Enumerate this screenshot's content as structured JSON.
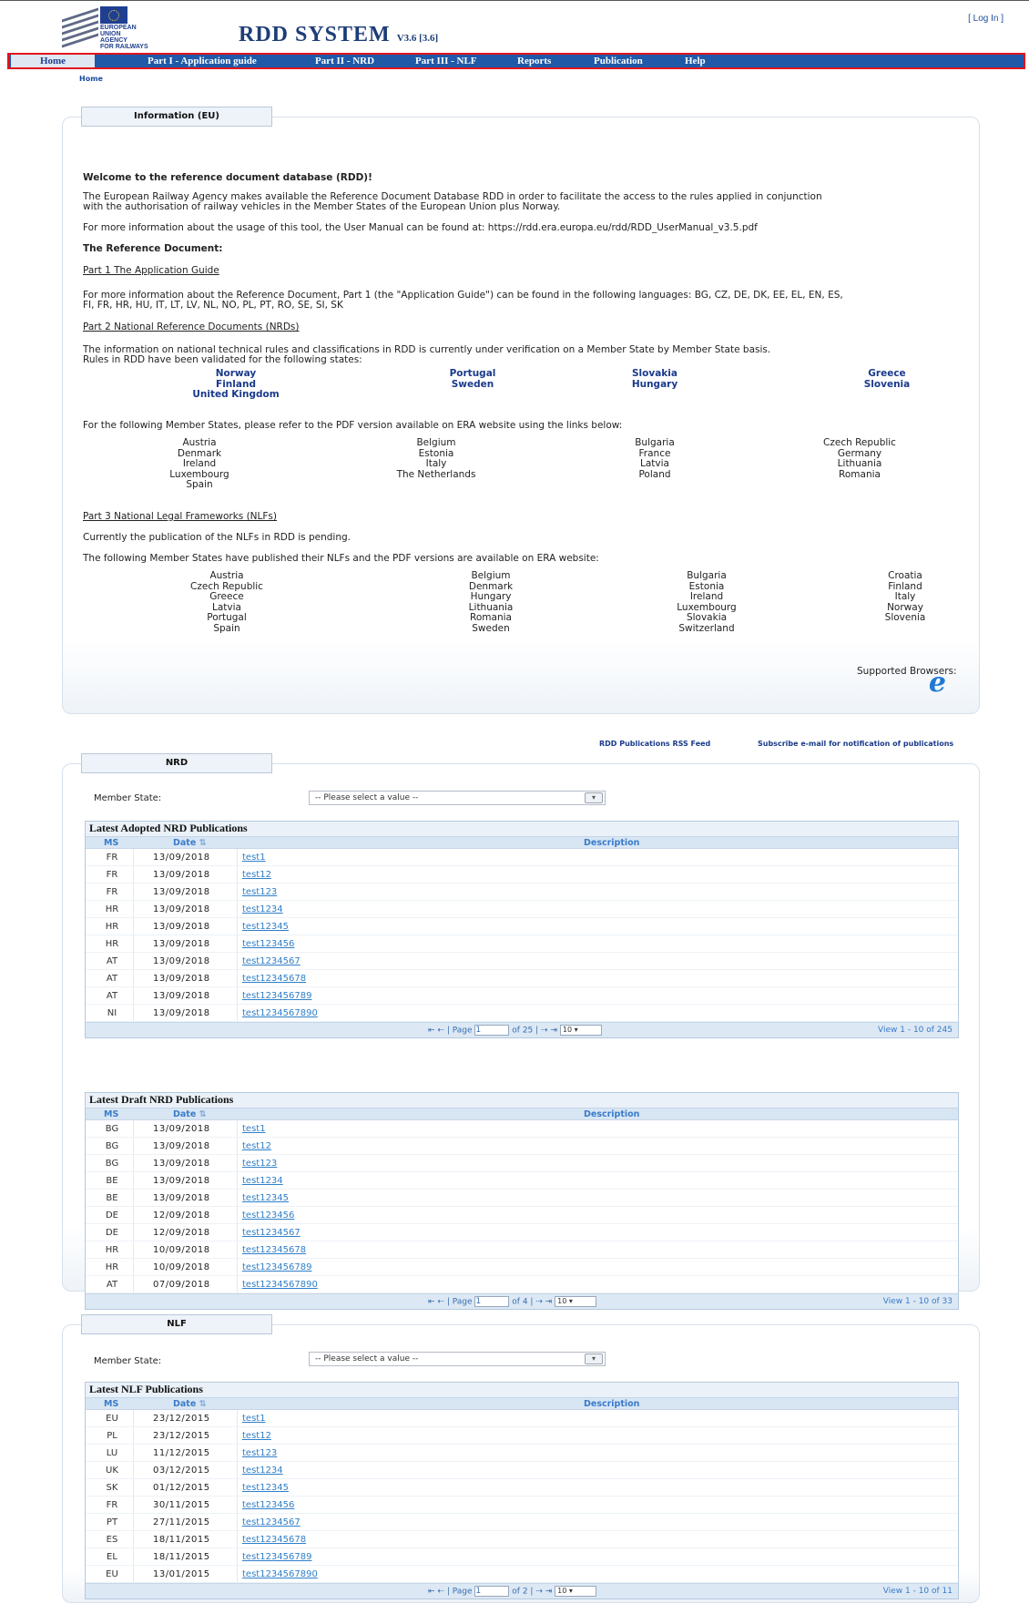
{
  "header": {
    "logo_lines": [
      "EUROPEAN",
      "UNION",
      "AGENCY",
      "FOR RAILWAYS"
    ],
    "title": "RDD SYSTEM",
    "version": "V3.6 [3.6]",
    "login": "[ Log In ]"
  },
  "nav": {
    "items": [
      "Home",
      "Part I - Application guide",
      "Part II - NRD",
      "Part III - NLF",
      "Reports",
      "Publication",
      "Help"
    ]
  },
  "breadcrumb": "Home",
  "info": {
    "tab": "Information (EU)",
    "welcome": "Welcome to the reference document database (RDD)!",
    "intro_1": "The European Railway Agency makes available the Reference Document Database RDD in order to facilitate the access to the rules applied in conjunction",
    "intro_2": "with the authorisation of railway vehicles in the Member States of the European Union plus Norway.",
    "manual": "For more information about the usage of this tool, the User Manual can be found at: https://rdd.era.europa.eu/rdd/RDD_UserManual_v3.5.pdf",
    "ref_doc": "The Reference Document:",
    "part1_link": "Part 1 The Application Guide",
    "part1_text_1": "For more information about the Reference Document, Part 1 (the \"Application Guide\") can be found in the following languages: BG, CZ, DE, DK, EE, EL, EN, ES,",
    "part1_text_2": "FI, FR, HR, HU, IT, LT, LV, NL, NO, PL, PT, RO, SE, SI, SK",
    "part2_link": "Part 2 National Reference Documents (NRDs)",
    "part2_text_1": "The information on national technical rules and classifications in RDD is currently under verification on a Member State by Member State basis.",
    "part2_text_2": "Rules in RDD have been validated for the following states:",
    "validated_cols": [
      [
        "Norway",
        "Finland",
        "United Kingdom"
      ],
      [
        "Portugal",
        "Sweden"
      ],
      [
        "Slovakia",
        "Hungary"
      ],
      [
        "Greece",
        "Slovenia"
      ]
    ],
    "pdf_text": "For the following Member States, please refer to the PDF version available on ERA website using the links below:",
    "pdf_cols": [
      [
        "Austria",
        "Denmark",
        "Ireland",
        "Luxembourg",
        "Spain"
      ],
      [
        "Belgium",
        "Estonia",
        "Italy",
        "The Netherlands"
      ],
      [
        "Bulgaria",
        "France",
        "Latvia",
        "Poland"
      ],
      [
        "Czech Republic",
        "Germany",
        "Lithuania",
        "Romania"
      ]
    ],
    "part3_link": "Part 3 National Legal Frameworks (NLFs)",
    "part3_pending": "Currently the publication of the NLFs in RDD is pending.",
    "nlf_text": "The following Member States have published their NLFs and the PDF versions are available on ERA website:",
    "nlf_cols": [
      [
        "Austria",
        "Czech Republic",
        "Greece",
        "Latvia",
        "Portugal",
        "Spain"
      ],
      [
        "Belgium",
        "Denmark",
        "Hungary",
        "Lithuania",
        "Romania",
        "Sweden"
      ],
      [
        "Bulgaria",
        "Estonia",
        "Ireland",
        "Luxembourg",
        "Slovakia",
        "Switzerland"
      ],
      [
        "Croatia",
        "Finland",
        "Italy",
        "Norway",
        "Slovenia"
      ]
    ],
    "browsers": "Supported Browsers:"
  },
  "links": {
    "rss": "RDD Publications RSS Feed",
    "subscribe": "Subscribe e-mail for notification of publications"
  },
  "nrd": {
    "tab": "NRD",
    "member_label": "Member State:",
    "select_placeholder": "-- Please select a value --",
    "headers": {
      "ms": "MS",
      "date": "Date",
      "desc": "Description"
    },
    "adopted": {
      "title": "Latest Adopted NRD Publications",
      "rows": [
        [
          "FR",
          "13/09/2018",
          "test1"
        ],
        [
          "FR",
          "13/09/2018",
          "test12"
        ],
        [
          "FR",
          "13/09/2018",
          "test123"
        ],
        [
          "HR",
          "13/09/2018",
          "test1234"
        ],
        [
          "HR",
          "13/09/2018",
          "test12345"
        ],
        [
          "HR",
          "13/09/2018",
          "test123456"
        ],
        [
          "AT",
          "13/09/2018",
          "test1234567"
        ],
        [
          "AT",
          "13/09/2018",
          "test12345678"
        ],
        [
          "AT",
          "13/09/2018",
          "test123456789"
        ],
        [
          "NI",
          "13/09/2018",
          "test1234567890"
        ]
      ],
      "page_label": "Page",
      "page_value": "1",
      "of": "of 25",
      "per_page": "10",
      "view": "View 1 - 10 of 245"
    },
    "draft": {
      "title": "Latest Draft NRD Publications",
      "rows": [
        [
          "BG",
          "13/09/2018",
          "test1"
        ],
        [
          "BG",
          "13/09/2018",
          "test12"
        ],
        [
          "BG",
          "13/09/2018",
          "test123"
        ],
        [
          "BE",
          "13/09/2018",
          "test1234"
        ],
        [
          "BE",
          "13/09/2018",
          "test12345"
        ],
        [
          "DE",
          "12/09/2018",
          "test123456"
        ],
        [
          "DE",
          "12/09/2018",
          "test1234567"
        ],
        [
          "HR",
          "10/09/2018",
          "test12345678"
        ],
        [
          "HR",
          "10/09/2018",
          "test123456789"
        ],
        [
          "AT",
          "07/09/2018",
          "test1234567890"
        ]
      ],
      "page_label": "Page",
      "page_value": "1",
      "of": "of 4",
      "per_page": "10",
      "view": "View 1 - 10 of 33"
    }
  },
  "nlf": {
    "tab": "NLF",
    "member_label": "Member State:",
    "select_placeholder": "-- Please select a value --",
    "headers": {
      "ms": "MS",
      "date": "Date",
      "desc": "Description"
    },
    "latest": {
      "title": "Latest NLF Publications",
      "rows": [
        [
          "EU",
          "23/12/2015",
          "test1"
        ],
        [
          "PL",
          "23/12/2015",
          "test12"
        ],
        [
          "LU",
          "11/12/2015",
          "test123"
        ],
        [
          "UK",
          "03/12/2015",
          "test1234"
        ],
        [
          "SK",
          "01/12/2015",
          "test12345"
        ],
        [
          "FR",
          "30/11/2015",
          "test123456"
        ],
        [
          "PT",
          "27/11/2015",
          "test1234567"
        ],
        [
          "ES",
          "18/11/2015",
          "test12345678"
        ],
        [
          "EL",
          "18/11/2015",
          "test123456789"
        ],
        [
          "EU",
          "13/01/2015",
          "test1234567890"
        ]
      ],
      "page_label": "Page",
      "page_value": "1",
      "of": "of 2",
      "per_page": "10",
      "view": "View 1 - 10 of 11"
    }
  },
  "colors": {
    "nav": "#1f59a8",
    "nav_border": "#e2131d",
    "title": "#1d3d77",
    "link": "#2f7fc8"
  }
}
